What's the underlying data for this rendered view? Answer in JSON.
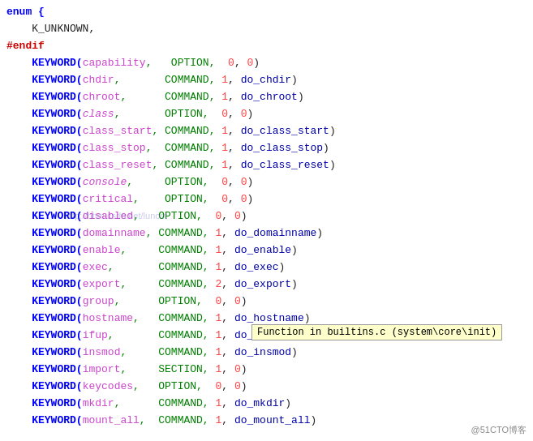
{
  "lines": [
    {
      "num": "",
      "content": [
        {
          "t": "enum {",
          "c": "kw-enum"
        }
      ]
    },
    {
      "num": "",
      "content": [
        {
          "t": "    K_UNKNOWN,",
          "c": "kw-plain"
        }
      ]
    },
    {
      "num": "",
      "content": [
        {
          "t": "#endif",
          "c": "kw-hash"
        }
      ]
    },
    {
      "num": "",
      "content": [
        {
          "t": "    KEYWORD(",
          "c": "kw-keyword"
        },
        {
          "t": "capability",
          "c": "kw-name"
        },
        {
          "t": ",   OPTION,  ",
          "c": "kw-option"
        },
        {
          "t": "0",
          "c": "kw-number"
        },
        {
          "t": ", ",
          "c": "kw-plain"
        },
        {
          "t": "0",
          "c": "kw-number"
        },
        {
          "t": ")",
          "c": "kw-plain"
        }
      ]
    },
    {
      "num": "",
      "content": [
        {
          "t": "    KEYWORD(",
          "c": "kw-keyword"
        },
        {
          "t": "chdir",
          "c": "kw-name"
        },
        {
          "t": ",       COMMAND, ",
          "c": "kw-command"
        },
        {
          "t": "1",
          "c": "kw-number"
        },
        {
          "t": ", ",
          "c": "kw-plain"
        },
        {
          "t": "do_chdir",
          "c": "kw-func"
        },
        {
          "t": ")",
          "c": "kw-plain"
        }
      ]
    },
    {
      "num": "",
      "content": [
        {
          "t": "    KEYWORD(",
          "c": "kw-keyword"
        },
        {
          "t": "chroot",
          "c": "kw-name"
        },
        {
          "t": ",      COMMAND, ",
          "c": "kw-command"
        },
        {
          "t": "1",
          "c": "kw-number"
        },
        {
          "t": ", ",
          "c": "kw-plain"
        },
        {
          "t": "do_chroot",
          "c": "kw-func"
        },
        {
          "t": ")",
          "c": "kw-plain"
        }
      ]
    },
    {
      "num": "",
      "content": [
        {
          "t": "    KEYWORD(",
          "c": "kw-keyword"
        },
        {
          "t": "class",
          "c": "kw-italic-name"
        },
        {
          "t": ",       OPTION,  ",
          "c": "kw-option"
        },
        {
          "t": "0",
          "c": "kw-number"
        },
        {
          "t": ", ",
          "c": "kw-plain"
        },
        {
          "t": "0",
          "c": "kw-number"
        },
        {
          "t": ")",
          "c": "kw-plain"
        }
      ]
    },
    {
      "num": "",
      "content": [
        {
          "t": "    KEYWORD(",
          "c": "kw-keyword"
        },
        {
          "t": "class_start",
          "c": "kw-name"
        },
        {
          "t": ", COMMAND, ",
          "c": "kw-command"
        },
        {
          "t": "1",
          "c": "kw-number"
        },
        {
          "t": ", ",
          "c": "kw-plain"
        },
        {
          "t": "do_class_start",
          "c": "kw-func"
        },
        {
          "t": ")",
          "c": "kw-plain"
        }
      ]
    },
    {
      "num": "",
      "content": [
        {
          "t": "    KEYWORD(",
          "c": "kw-keyword"
        },
        {
          "t": "class_stop",
          "c": "kw-name"
        },
        {
          "t": ",  COMMAND, ",
          "c": "kw-command"
        },
        {
          "t": "1",
          "c": "kw-number"
        },
        {
          "t": ", ",
          "c": "kw-plain"
        },
        {
          "t": "do_class_stop",
          "c": "kw-func"
        },
        {
          "t": ")",
          "c": "kw-plain"
        }
      ]
    },
    {
      "num": "",
      "content": [
        {
          "t": "    KEYWORD(",
          "c": "kw-keyword"
        },
        {
          "t": "class_reset",
          "c": "kw-name"
        },
        {
          "t": ", COMMAND, ",
          "c": "kw-command"
        },
        {
          "t": "1",
          "c": "kw-number"
        },
        {
          "t": ", ",
          "c": "kw-plain"
        },
        {
          "t": "do_class_reset",
          "c": "kw-func"
        },
        {
          "t": ")",
          "c": "kw-plain"
        }
      ]
    },
    {
      "num": "",
      "content": [
        {
          "t": "    KEYWORD(",
          "c": "kw-keyword"
        },
        {
          "t": "console",
          "c": "kw-italic-name"
        },
        {
          "t": ",     OPTION,  ",
          "c": "kw-option"
        },
        {
          "t": "0",
          "c": "kw-number"
        },
        {
          "t": ", ",
          "c": "kw-plain"
        },
        {
          "t": "0",
          "c": "kw-number"
        },
        {
          "t": ")",
          "c": "kw-plain"
        }
      ]
    },
    {
      "num": "",
      "content": [
        {
          "t": "    KEYWORD(",
          "c": "kw-keyword"
        },
        {
          "t": "critical",
          "c": "kw-name"
        },
        {
          "t": ",    OPTION,  ",
          "c": "kw-option"
        },
        {
          "t": "0",
          "c": "kw-number"
        },
        {
          "t": ", ",
          "c": "kw-plain"
        },
        {
          "t": "0",
          "c": "kw-number"
        },
        {
          "t": ")",
          "c": "kw-plain"
        }
      ]
    },
    {
      "num": "",
      "content": [
        {
          "t": "    KEYWORD(",
          "c": "kw-keyword"
        },
        {
          "t": "disabled",
          "c": "kw-name"
        },
        {
          "t": ",   OPTION,  ",
          "c": "kw-option"
        },
        {
          "t": "0",
          "c": "kw-number"
        },
        {
          "t": ", ",
          "c": "kw-plain"
        },
        {
          "t": "0",
          "c": "kw-number"
        },
        {
          "t": ")",
          "c": "kw-plain"
        }
      ]
    },
    {
      "num": "",
      "content": [
        {
          "t": "    KEYWORD(",
          "c": "kw-keyword"
        },
        {
          "t": "domainname",
          "c": "kw-name"
        },
        {
          "t": ", COMMAND, ",
          "c": "kw-command"
        },
        {
          "t": "1",
          "c": "kw-number"
        },
        {
          "t": ", ",
          "c": "kw-plain"
        },
        {
          "t": "do_domainname",
          "c": "kw-func"
        },
        {
          "t": ")",
          "c": "kw-plain"
        }
      ]
    },
    {
      "num": "",
      "content": [
        {
          "t": "    KEYWORD(",
          "c": "kw-keyword"
        },
        {
          "t": "enable",
          "c": "kw-name"
        },
        {
          "t": ",     COMMAND, ",
          "c": "kw-command"
        },
        {
          "t": "1",
          "c": "kw-number"
        },
        {
          "t": ", ",
          "c": "kw-plain"
        },
        {
          "t": "do_enable",
          "c": "kw-func"
        },
        {
          "t": ")",
          "c": "kw-plain"
        }
      ]
    },
    {
      "num": "",
      "content": [
        {
          "t": "    KEYWORD(",
          "c": "kw-keyword"
        },
        {
          "t": "exec",
          "c": "kw-name"
        },
        {
          "t": ",       COMMAND, ",
          "c": "kw-command"
        },
        {
          "t": "1",
          "c": "kw-number"
        },
        {
          "t": ", ",
          "c": "kw-plain"
        },
        {
          "t": "do_exec",
          "c": "kw-func"
        },
        {
          "t": ")",
          "c": "kw-plain"
        }
      ]
    },
    {
      "num": "",
      "content": [
        {
          "t": "    KEYWORD(",
          "c": "kw-keyword"
        },
        {
          "t": "export",
          "c": "kw-name"
        },
        {
          "t": ",     COMMAND, ",
          "c": "kw-command"
        },
        {
          "t": "2",
          "c": "kw-number"
        },
        {
          "t": ", ",
          "c": "kw-plain"
        },
        {
          "t": "do_export",
          "c": "kw-func"
        },
        {
          "t": ")",
          "c": "kw-plain"
        }
      ]
    },
    {
      "num": "",
      "content": [
        {
          "t": "    KEYWORD(",
          "c": "kw-keyword"
        },
        {
          "t": "group",
          "c": "kw-name"
        },
        {
          "t": ",      OPTION,  ",
          "c": "kw-option"
        },
        {
          "t": "0",
          "c": "kw-number"
        },
        {
          "t": ", ",
          "c": "kw-plain"
        },
        {
          "t": "0",
          "c": "kw-number"
        },
        {
          "t": ")",
          "c": "kw-plain"
        }
      ]
    },
    {
      "num": "",
      "content": [
        {
          "t": "    KEYWORD(",
          "c": "kw-keyword"
        },
        {
          "t": "hostname",
          "c": "kw-name"
        },
        {
          "t": ",   COMMAND, ",
          "c": "kw-command"
        },
        {
          "t": "1",
          "c": "kw-number"
        },
        {
          "t": ", ",
          "c": "kw-plain"
        },
        {
          "t": "do_hostname",
          "c": "kw-func"
        },
        {
          "t": ")",
          "c": "kw-plain"
        }
      ]
    },
    {
      "num": "",
      "content": [
        {
          "t": "    KEYWORD(",
          "c": "kw-keyword"
        },
        {
          "t": "ifup",
          "c": "kw-name"
        },
        {
          "t": ",       COMMAND, ",
          "c": "kw-command"
        },
        {
          "t": "1",
          "c": "kw-number"
        },
        {
          "t": ", ",
          "c": "kw-plain"
        },
        {
          "t": "do_if",
          "c": "kw-func"
        }
      ]
    },
    {
      "num": "",
      "content": [
        {
          "t": "    KEYWORD(",
          "c": "kw-keyword"
        },
        {
          "t": "insmod",
          "c": "kw-name"
        },
        {
          "t": ",     COMMAND, ",
          "c": "kw-command"
        },
        {
          "t": "1",
          "c": "kw-number"
        },
        {
          "t": ", ",
          "c": "kw-plain"
        },
        {
          "t": "do_insmod",
          "c": "kw-func"
        },
        {
          "t": ")",
          "c": "kw-plain"
        }
      ]
    },
    {
      "num": "",
      "content": [
        {
          "t": "    KEYWORD(",
          "c": "kw-keyword"
        },
        {
          "t": "import",
          "c": "kw-name"
        },
        {
          "t": ",     SECTION, ",
          "c": "kw-section"
        },
        {
          "t": "1",
          "c": "kw-number"
        },
        {
          "t": ", ",
          "c": "kw-plain"
        },
        {
          "t": "0",
          "c": "kw-number"
        },
        {
          "t": ")",
          "c": "kw-plain"
        }
      ]
    },
    {
      "num": "",
      "content": [
        {
          "t": "    KEYWORD(",
          "c": "kw-keyword"
        },
        {
          "t": "keycodes",
          "c": "kw-name"
        },
        {
          "t": ",   OPTION,  ",
          "c": "kw-option"
        },
        {
          "t": "0",
          "c": "kw-number"
        },
        {
          "t": ", ",
          "c": "kw-plain"
        },
        {
          "t": "0",
          "c": "kw-number"
        },
        {
          "t": ")",
          "c": "kw-plain"
        }
      ]
    },
    {
      "num": "",
      "content": [
        {
          "t": "    KEYWORD(",
          "c": "kw-keyword"
        },
        {
          "t": "mkdir",
          "c": "kw-name"
        },
        {
          "t": ",      COMMAND, ",
          "c": "kw-command"
        },
        {
          "t": "1",
          "c": "kw-number"
        },
        {
          "t": ", ",
          "c": "kw-plain"
        },
        {
          "t": "do_mkdir",
          "c": "kw-func"
        },
        {
          "t": ")",
          "c": "kw-plain"
        }
      ]
    },
    {
      "num": "",
      "content": [
        {
          "t": "    KEYWORD(",
          "c": "kw-keyword"
        },
        {
          "t": "mount_all",
          "c": "kw-name"
        },
        {
          "t": ",  COMMAND, ",
          "c": "kw-command"
        },
        {
          "t": "1",
          "c": "kw-number"
        },
        {
          "t": ", ",
          "c": "kw-plain"
        },
        {
          "t": "do_mount_all",
          "c": "kw-func"
        },
        {
          "t": ")",
          "c": "kw-plain"
        }
      ]
    }
  ],
  "tooltip": {
    "text": "Function in builtins.c (system\\core\\init)",
    "visible": true
  },
  "watermark": "http://httm.csdn.net/lunost",
  "logo": "@51CTO博客"
}
